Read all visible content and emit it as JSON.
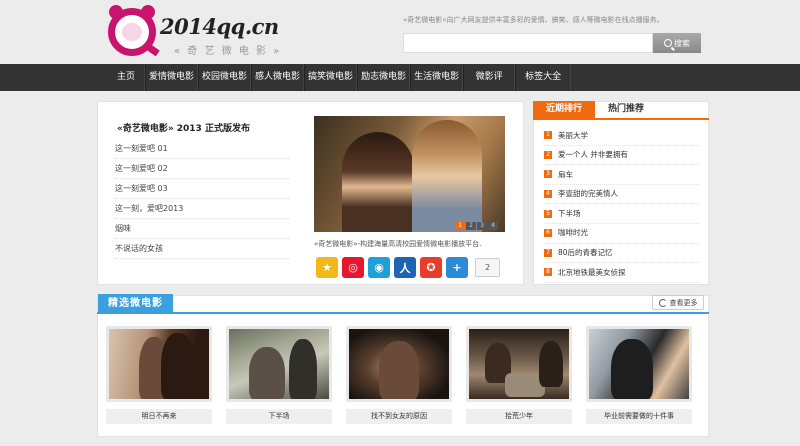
{
  "header": {
    "logo_text": "2014qq.cn",
    "logo_sub": "« 奇 艺 微 电 影 »",
    "tagline": "«奇艺微电影»向广大网友提供丰富多彩的爱情、搞笑、感人等微电影在线点播服务。",
    "search": {
      "placeholder": "",
      "button_label": "搜索"
    }
  },
  "nav": {
    "items": [
      {
        "label": "主页"
      },
      {
        "label": "爱情微电影"
      },
      {
        "label": "校园微电影"
      },
      {
        "label": "感人微电影"
      },
      {
        "label": "搞笑微电影"
      },
      {
        "label": "励志微电影"
      },
      {
        "label": "生活微电影"
      },
      {
        "label": "微影评"
      },
      {
        "label": "标签大全"
      }
    ]
  },
  "news": {
    "title": "«奇艺微电影» 2013 正式版发布",
    "items": [
      {
        "label": "这一刻爱吧 01"
      },
      {
        "label": "这一刻爱吧 02"
      },
      {
        "label": "这一刻爱吧 03"
      },
      {
        "label": "这一刻，爱吧2013"
      },
      {
        "label": "烟味"
      },
      {
        "label": "不说话的女孩"
      }
    ]
  },
  "feature": {
    "caption": "«奇艺微电影»-构建海量高清校园爱情微电影播放平台.",
    "dots": [
      "1",
      "2",
      "3",
      "4"
    ]
  },
  "share": {
    "icons": [
      {
        "name": "qzone-icon",
        "glyph": "★",
        "color": "#f2b818"
      },
      {
        "name": "weibo-icon",
        "glyph": "◎",
        "color": "#e6162d"
      },
      {
        "name": "tqq-icon",
        "glyph": "◉",
        "color": "#1fa0d8"
      },
      {
        "name": "renren-icon",
        "glyph": "人",
        "color": "#1d64b2"
      },
      {
        "name": "qq-icon",
        "glyph": "✪",
        "color": "#e83c2c"
      },
      {
        "name": "more-share-icon",
        "glyph": "+",
        "color": "#2b8bd6"
      }
    ],
    "count": "2"
  },
  "rank": {
    "tabs": [
      {
        "label": "近期排行",
        "active": true
      },
      {
        "label": "热门推荐",
        "active": false
      }
    ],
    "items": [
      {
        "num": "1",
        "label": "美丽大学"
      },
      {
        "num": "2",
        "label": "爱一个人 并非要拥有"
      },
      {
        "num": "3",
        "label": "扇车"
      },
      {
        "num": "4",
        "label": "李壹甜的完美情人"
      },
      {
        "num": "5",
        "label": "下半场"
      },
      {
        "num": "6",
        "label": "咖啡时光"
      },
      {
        "num": "7",
        "label": "80后的青春记忆"
      },
      {
        "num": "8",
        "label": "北京地铁最美女侦探"
      }
    ]
  },
  "picks": {
    "title": "精选微电影",
    "more_label": "查看更多",
    "items": [
      {
        "caption": "明日不再来"
      },
      {
        "caption": "下半场"
      },
      {
        "caption": "找不到女友的原因"
      },
      {
        "caption": "拾荒少年"
      },
      {
        "caption": "毕业前需要做的十件事"
      }
    ]
  },
  "colors": {
    "accent_orange": "#f06a10",
    "accent_blue": "#3aa0e0",
    "brand_pink": "#c8146e",
    "nav_bg": "#333333"
  }
}
